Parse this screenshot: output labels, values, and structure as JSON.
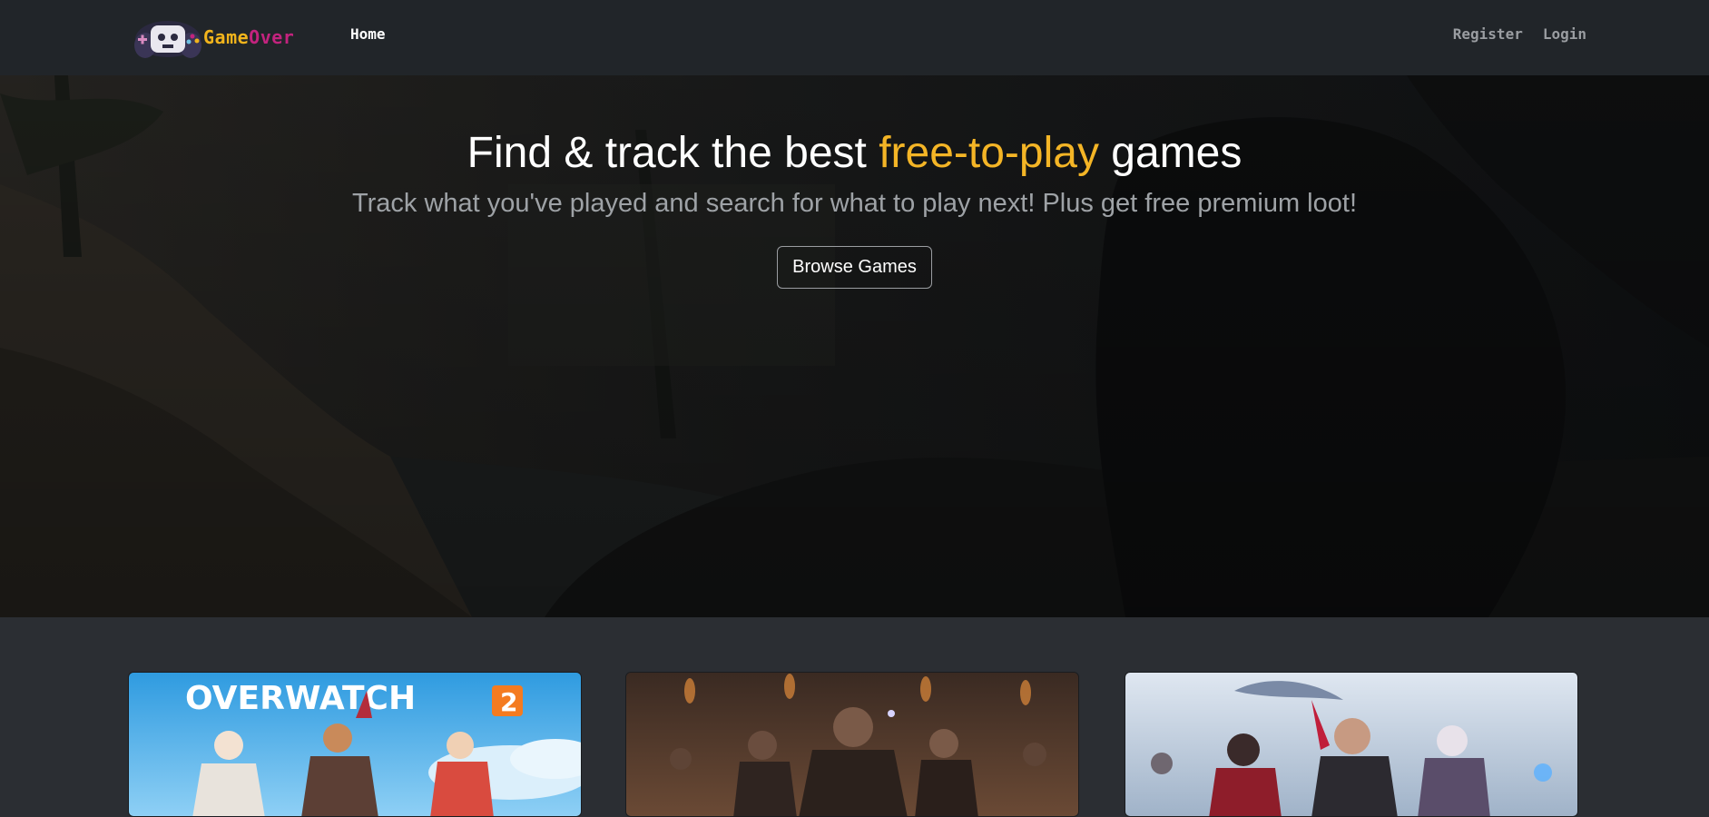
{
  "brand": {
    "name_part1": "Game",
    "name_part2": "Over",
    "logo_icon": "gamepad-skull-icon",
    "colors": {
      "game": "#f2b41c",
      "over": "#c3237e"
    }
  },
  "nav": {
    "home_label": "Home",
    "register_label": "Register",
    "login_label": "Login"
  },
  "hero": {
    "title_before": "Find & track the best ",
    "title_accent": "free-to-play",
    "title_after": " games",
    "subtitle": "Track what you've played and search for what to play next! Plus get free premium loot!",
    "button_label": "Browse Games",
    "accent_color": "#f4b526"
  },
  "games": [
    {
      "title_text": "OVERWATCH",
      "title_badge": "2"
    },
    {},
    {}
  ]
}
